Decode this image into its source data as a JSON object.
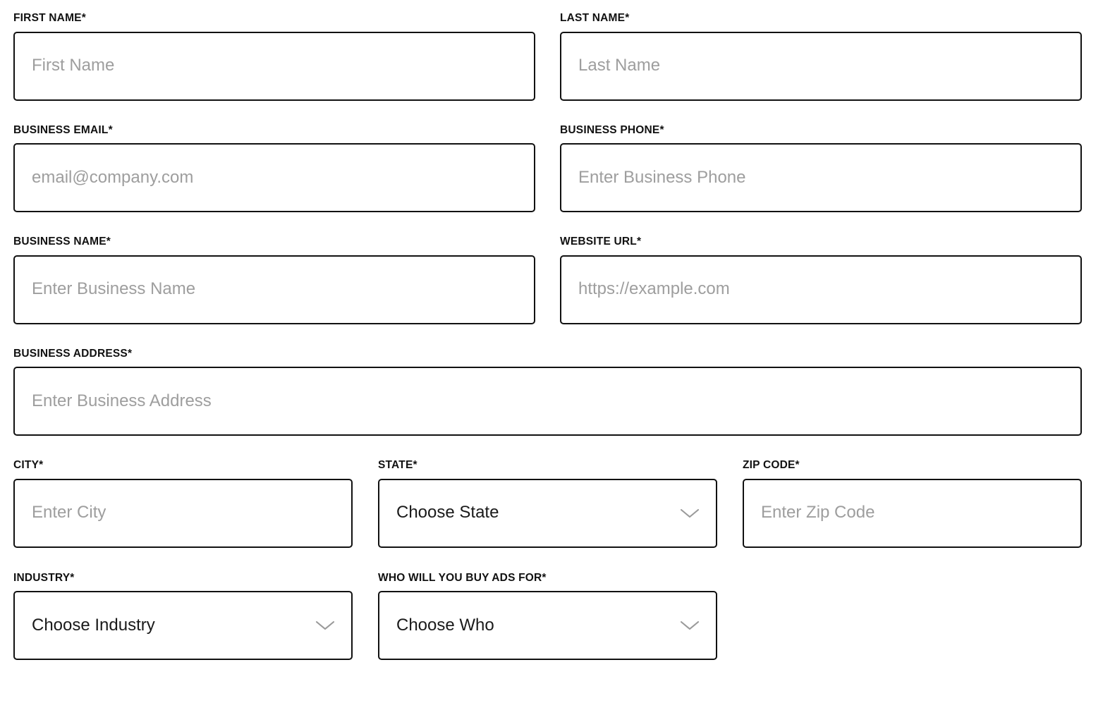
{
  "colors": {
    "border": "#111111",
    "label": "#111111",
    "placeholder": "#9e9e9e",
    "value": "#1a1a1a",
    "chevron": "#9a9a9a",
    "background": "#ffffff"
  },
  "form": {
    "rows": [
      {
        "layout": "two-column",
        "fields": [
          {
            "label": "FIRST NAME*",
            "type": "text",
            "placeholder": "First Name",
            "value": "",
            "name": "first-name"
          },
          {
            "label": "LAST NAME*",
            "type": "text",
            "placeholder": "Last Name",
            "value": "",
            "name": "last-name"
          }
        ]
      },
      {
        "layout": "two-column",
        "fields": [
          {
            "label": "BUSINESS EMAIL*",
            "type": "email",
            "placeholder": "email@company.com",
            "value": "",
            "name": "business-email"
          },
          {
            "label": "BUSINESS PHONE*",
            "type": "tel",
            "placeholder": "Enter Business Phone",
            "value": "",
            "name": "business-phone"
          }
        ]
      },
      {
        "layout": "two-column",
        "fields": [
          {
            "label": "BUSINESS NAME*",
            "type": "text",
            "placeholder": "Enter Business Name",
            "value": "",
            "name": "business-name"
          },
          {
            "label": "WEBSITE URL*",
            "type": "url",
            "placeholder": "https://example.com",
            "value": "",
            "name": "website-url"
          }
        ]
      },
      {
        "layout": "full-width",
        "fields": [
          {
            "label": "BUSINESS ADDRESS*",
            "type": "text",
            "placeholder": "Enter Business Address",
            "value": "",
            "name": "business-address"
          }
        ]
      },
      {
        "layout": "three-column",
        "fields": [
          {
            "label": "CITY*",
            "type": "text",
            "placeholder": "Enter City",
            "value": "",
            "name": "city"
          },
          {
            "label": "STATE*",
            "type": "select",
            "placeholder": "",
            "value": "Choose State",
            "name": "state"
          },
          {
            "label": "ZIP CODE*",
            "type": "text",
            "placeholder": "Enter Zip Code",
            "value": "",
            "name": "zip-code"
          }
        ]
      },
      {
        "layout": "three-column",
        "fields": [
          {
            "label": "INDUSTRY*",
            "type": "select",
            "placeholder": "",
            "value": "Choose Industry",
            "name": "industry"
          },
          {
            "label": "WHO WILL YOU BUY ADS FOR*",
            "type": "select",
            "placeholder": "",
            "value": "Choose Who",
            "name": "who-will-you-buy-ads-for"
          }
        ]
      }
    ]
  },
  "icons": {
    "dropdown": "chevron-down-icon"
  }
}
